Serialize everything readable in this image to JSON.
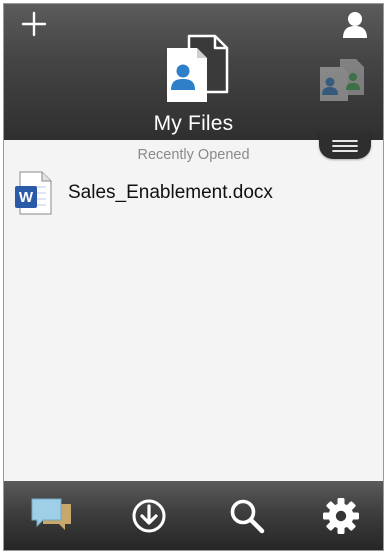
{
  "header": {
    "title": "My Files",
    "add_icon": "plus-icon",
    "user_icon": "user-icon",
    "main_icon": "documents-icon",
    "side_icon": "shared-documents-icon",
    "menu_icon": "hamburger-menu-icon"
  },
  "recent": {
    "section_label": "Recently Opened",
    "files": [
      {
        "name": "Sales_Enablement.docx",
        "icon": "word-document-icon"
      }
    ]
  },
  "toolbar": {
    "items": [
      {
        "icon": "chat-icon"
      },
      {
        "icon": "download-icon"
      },
      {
        "icon": "search-icon"
      },
      {
        "icon": "settings-gear-icon"
      }
    ]
  },
  "colors": {
    "header_dark": "#2f2f2f",
    "background": "#f4f4f4",
    "accent_blue": "#2f7fc8",
    "word_blue": "#2a5aa8"
  }
}
